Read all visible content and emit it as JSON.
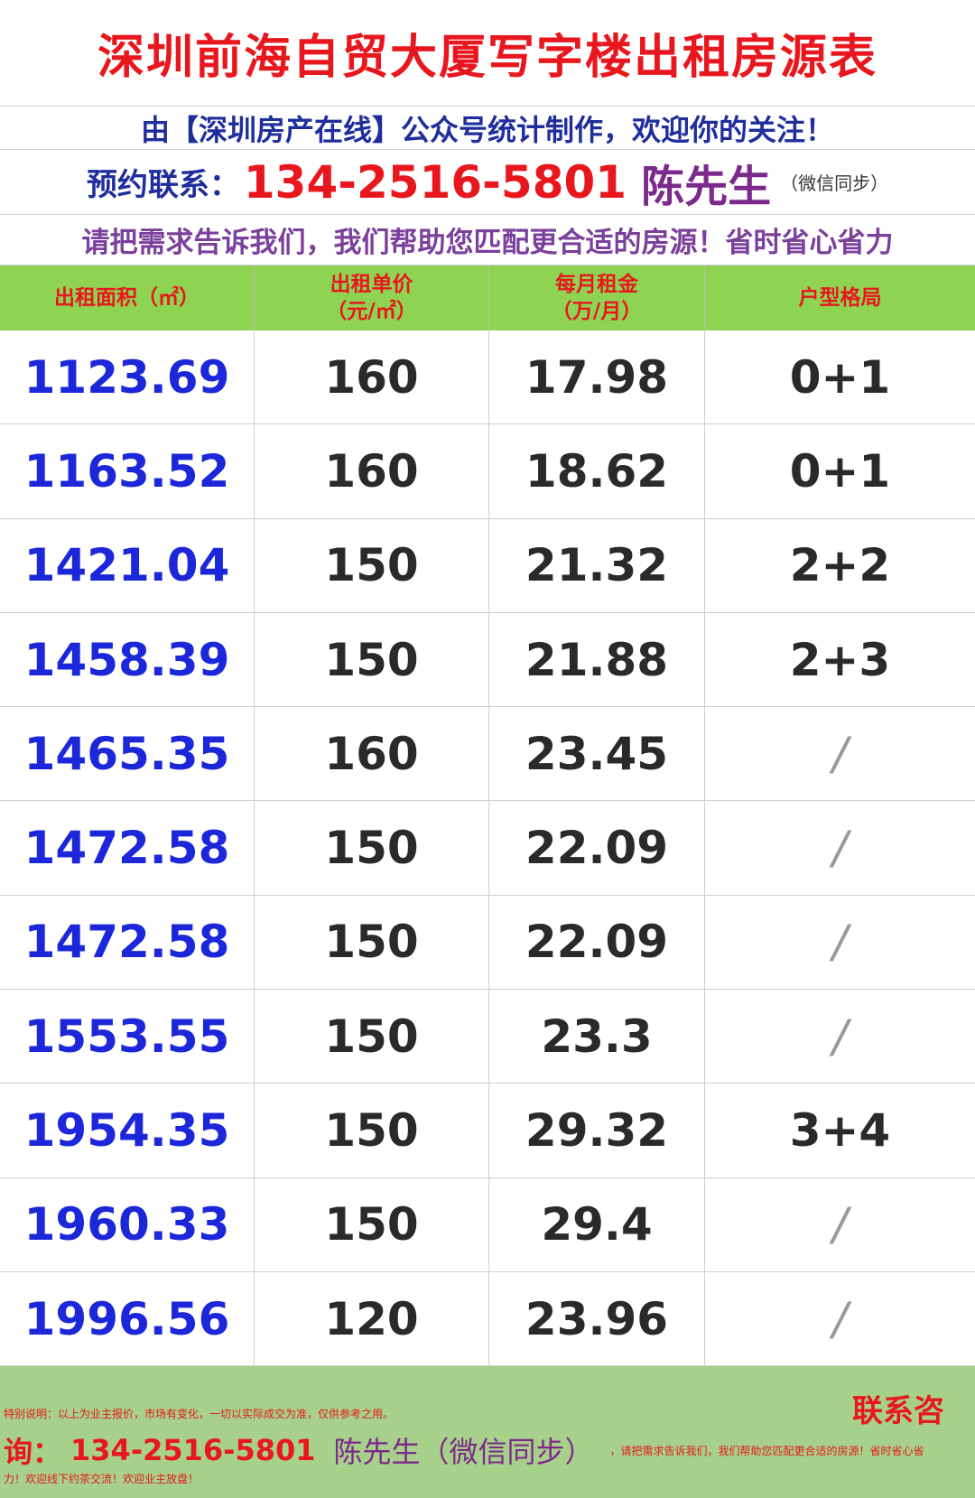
{
  "title": "深圳前海自贸大厦写字楼出租房源表",
  "subtitle": "由【深圳房产在线】公众号统计制作，欢迎你的关注！",
  "contact": {
    "label": "预约联系：",
    "phone": "134-2516-5801",
    "name": "陈先生",
    "note": "（微信同步）"
  },
  "slogan": "请把需求告诉我们，我们帮助您匹配更合适的房源！省时省心省力",
  "table": {
    "headers": [
      [
        "出租面积（㎡）"
      ],
      [
        "出租单价",
        "（元/㎡）"
      ],
      [
        "每月租金",
        "（万/月）"
      ],
      [
        "户型格局"
      ]
    ],
    "rows": [
      [
        "1123.69",
        "160",
        "17.98",
        "0+1"
      ],
      [
        "1163.52",
        "160",
        "18.62",
        "0+1"
      ],
      [
        "1421.04",
        "150",
        "21.32",
        "2+2"
      ],
      [
        "1458.39",
        "150",
        "21.88",
        "2+3"
      ],
      [
        "1465.35",
        "160",
        "23.45",
        "/"
      ],
      [
        "1472.58",
        "150",
        "22.09",
        "/"
      ],
      [
        "1472.58",
        "150",
        "22.09",
        "/"
      ],
      [
        "1553.55",
        "150",
        "23.3",
        "/"
      ],
      [
        "1954.35",
        "150",
        "29.32",
        "3+4"
      ],
      [
        "1960.33",
        "150",
        "29.4",
        "/"
      ],
      [
        "1996.56",
        "120",
        "23.96",
        "/"
      ]
    ]
  },
  "footer": {
    "contact_heading": "联系咨",
    "note": "特别说明：以上为业主报价，市场有变化，一切以实际成交为准，仅供参考之用。",
    "ask": "询：",
    "phone": "134-2516-5801",
    "name": "陈先生（微信同步）",
    "tail": "，请把需求告诉我们，我们帮助您匹配更合适的房源！省时省心省",
    "last": "力！欢迎线下约茶交流！欢迎业主放盘！"
  }
}
